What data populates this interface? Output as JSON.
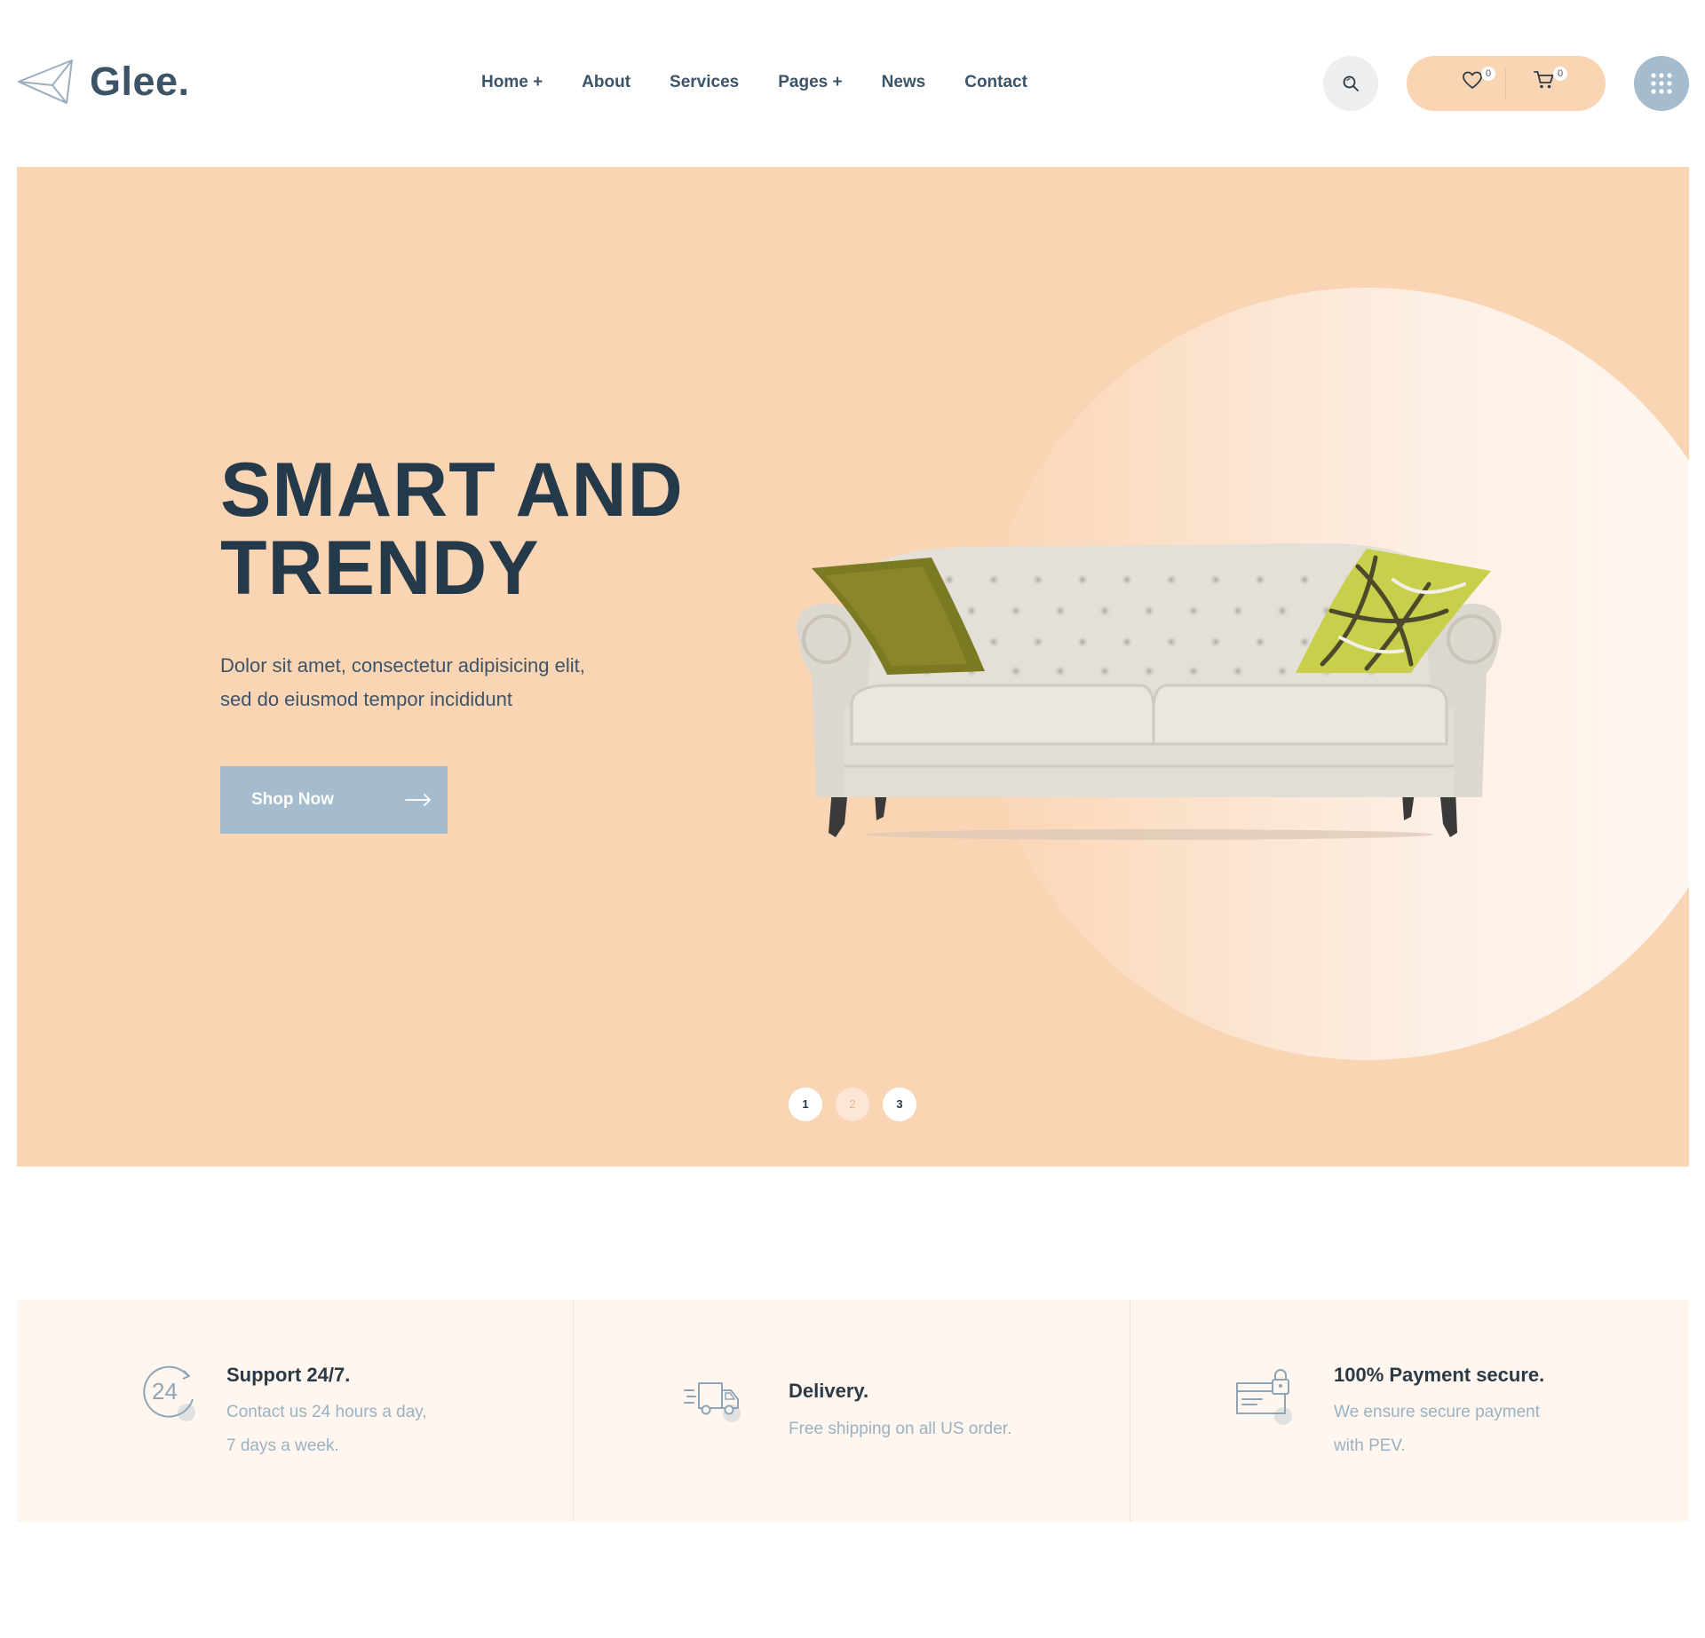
{
  "brand": {
    "name": "Glee."
  },
  "nav": {
    "items": [
      {
        "label": "Home +"
      },
      {
        "label": "About"
      },
      {
        "label": "Services"
      },
      {
        "label": "Pages +"
      },
      {
        "label": "News"
      },
      {
        "label": "Contact"
      }
    ]
  },
  "header": {
    "search_icon": "search-icon",
    "wishlist_count": "0",
    "cart_count": "0",
    "menu_icon": "grid-menu-icon"
  },
  "hero": {
    "title_line1": "SMART AND",
    "title_line2": "TRENDY",
    "text_line1": "Dolor sit amet, consectetur adipisicing elit,",
    "text_line2": "sed do eiusmod tempor incididunt",
    "button_label": "Shop Now",
    "slides": [
      "1",
      "2",
      "3"
    ]
  },
  "features": [
    {
      "icon": "support-24-icon",
      "title": "Support 24/7.",
      "desc_line1": "Contact us 24 hours a day,",
      "desc_line2": "7 days a week."
    },
    {
      "icon": "delivery-truck-icon",
      "title": "Delivery.",
      "desc_line1": "Free shipping on all US order.",
      "desc_line2": ""
    },
    {
      "icon": "secure-payment-icon",
      "title": "100% Payment secure.",
      "desc_line1": "We ensure secure payment",
      "desc_line2": "with PEV."
    }
  ],
  "colors": {
    "hero_bg": "#fad5b4",
    "accent_blue": "#a4bccd",
    "heading": "#24394a",
    "feature_bg": "#fef6ef"
  }
}
